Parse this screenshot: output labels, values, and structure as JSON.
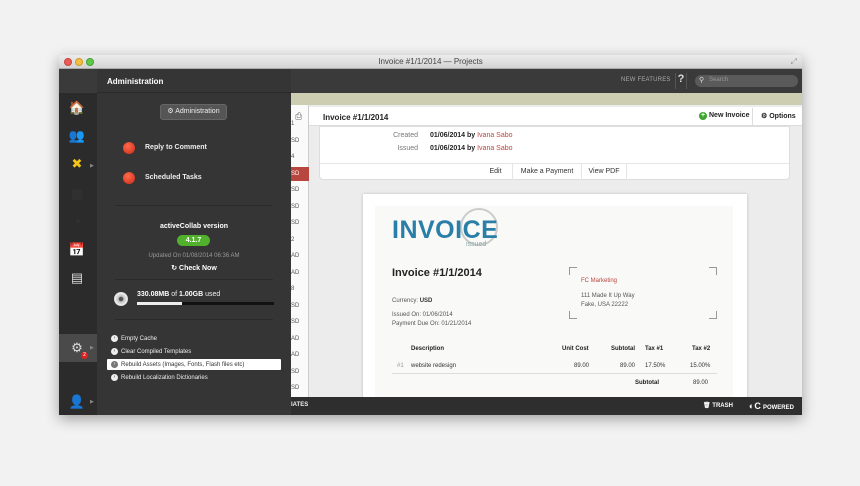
{
  "window": {
    "title": "Invoice #1/1/2014 — Projects"
  },
  "topbar": {
    "new_features": "NEW FEATURES",
    "help": "?",
    "search_placeholder": "Search"
  },
  "admin": {
    "header": "Administration",
    "button": "Administration",
    "items": [
      {
        "label": "Reply to Comment"
      },
      {
        "label": "Scheduled Tasks"
      }
    ],
    "version": {
      "label": "activeCollab version",
      "number": "4.1.7",
      "updated": "Updated On 01/08/2014 06:36 AM",
      "check": "Check Now"
    },
    "disk": {
      "used": "330.08MB",
      "of_word": "of",
      "total": "1.00GB",
      "suffix": "used",
      "fraction": 0.33
    },
    "tools": [
      "Empty Cache",
      "Clear Compiled Templates",
      "Rebuild Assets (Images, Fonts, Flash files etc)",
      "Rebuild Localization Dictionaries"
    ],
    "badge": "2"
  },
  "list_col": [
    "1",
    "SD",
    "4",
    "SD",
    "SD",
    "SD",
    "SD",
    "2",
    "AD",
    "AD",
    "8",
    "SD",
    "SD",
    "AD",
    "AD",
    "SD",
    "SD"
  ],
  "invoice": {
    "title": "Invoice #1/1/2014",
    "new_invoice": "New Invoice",
    "options": "Options",
    "created_key": "Created",
    "created_val": "01/06/2014 by",
    "created_by": "Ivana Sabo",
    "issued_key": "Issued",
    "issued_val": "01/06/2014 by",
    "issued_by": "Ivana Sabo",
    "actions": [
      "Edit",
      "Make a Payment",
      "View PDF"
    ]
  },
  "paper": {
    "logo": "INVOICE",
    "stamp": "issued",
    "title": "Invoice #1/1/2014",
    "currency_key": "Currency:",
    "currency_val": "USD",
    "issued_on": "Issued On: 01/06/2014",
    "due_on": "Payment Due On: 01/21/2014",
    "client_name": "FC Marketing",
    "client_addr1": "111 Made It Up Way",
    "client_addr2": "Fake, USA 22222",
    "headers": [
      "Description",
      "Unit Cost",
      "Subtotal",
      "Tax #1",
      "Tax #2"
    ],
    "row": {
      "num": "#1",
      "desc": "website redesign",
      "unit": "89.00",
      "subtotal": "89.00",
      "tax1": "17.50%",
      "tax2": "15.00%"
    },
    "subtotal_label": "Subtotal",
    "subtotal_val": "89.00"
  },
  "bottombar": {
    "left": "IATES",
    "trash": "TRASH",
    "powered": "POWERED"
  }
}
